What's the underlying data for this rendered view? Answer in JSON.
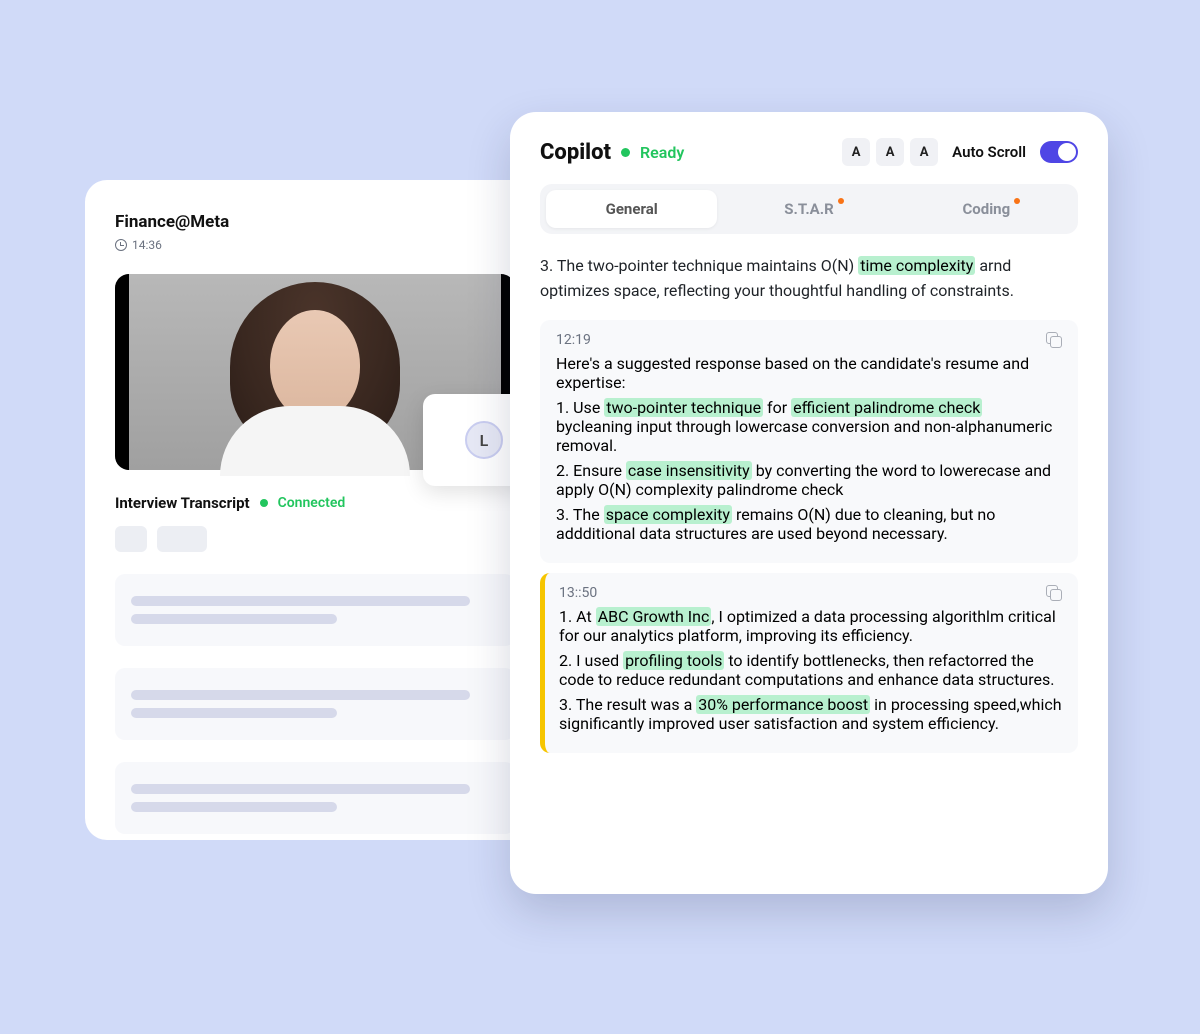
{
  "left_card": {
    "title": "Finance@Meta",
    "time": "14:36",
    "pip_initial": "L",
    "transcript": {
      "title": "Interview Transcript",
      "status": "Connected"
    }
  },
  "copilot": {
    "title": "Copilot",
    "status": "Ready",
    "font_buttons": [
      "A",
      "A",
      "A"
    ],
    "auto_scroll_label": "Auto Scroll",
    "tabs": [
      {
        "label": "General",
        "active": true,
        "has_dot": false
      },
      {
        "label": "S.T.A.R",
        "active": false,
        "has_dot": true
      },
      {
        "label": "Coding",
        "active": false,
        "has_dot": true
      }
    ],
    "lead_paragraph": {
      "prefix": "3. The two-pointer technique maintains O(N) ",
      "hl": "time complexity",
      "suffix": " arnd optimizes space, reflecting your thoughtful handling of constraints."
    },
    "message1": {
      "time": "12:19",
      "intro": "Here's a suggested response based on the candidate's resume and expertise:",
      "p1_a": "1. Use ",
      "p1_h1": "two-pointer technique",
      "p1_b": " for ",
      "p1_h2": "efficient palindrome check",
      "p1_c": " bycleaning input through lowercase conversion and non-alphanumeric removal.",
      "p2_a": "2. Ensure ",
      "p2_h1": "case insensitivity",
      "p2_b": " by converting the word to lowerecase and apply O(N) complexity palindrome check",
      "p3_a": "3. The ",
      "p3_h1": "space complexity",
      "p3_b": " remains O(N) due to cleaning, but no addditional data structures are used beyond necessary."
    },
    "message2": {
      "time": "13::50",
      "p1_a": "1. At ",
      "p1_h1": "ABC Growth Inc",
      "p1_b": ", I optimized a data processing algorithlm critical for our analytics platform, improving its efficiency.",
      "p2_a": "2. I used ",
      "p2_h1": "profiling tools",
      "p2_b": " to identify bottlenecks, then refactorred the code to reduce redundant computations and enhance data structures.",
      "p3_a": "3. The result was a ",
      "p3_h1": "30% performance boost",
      "p3_b": " in processing speed,which significantly improved user satisfaction and system efficiency."
    }
  }
}
